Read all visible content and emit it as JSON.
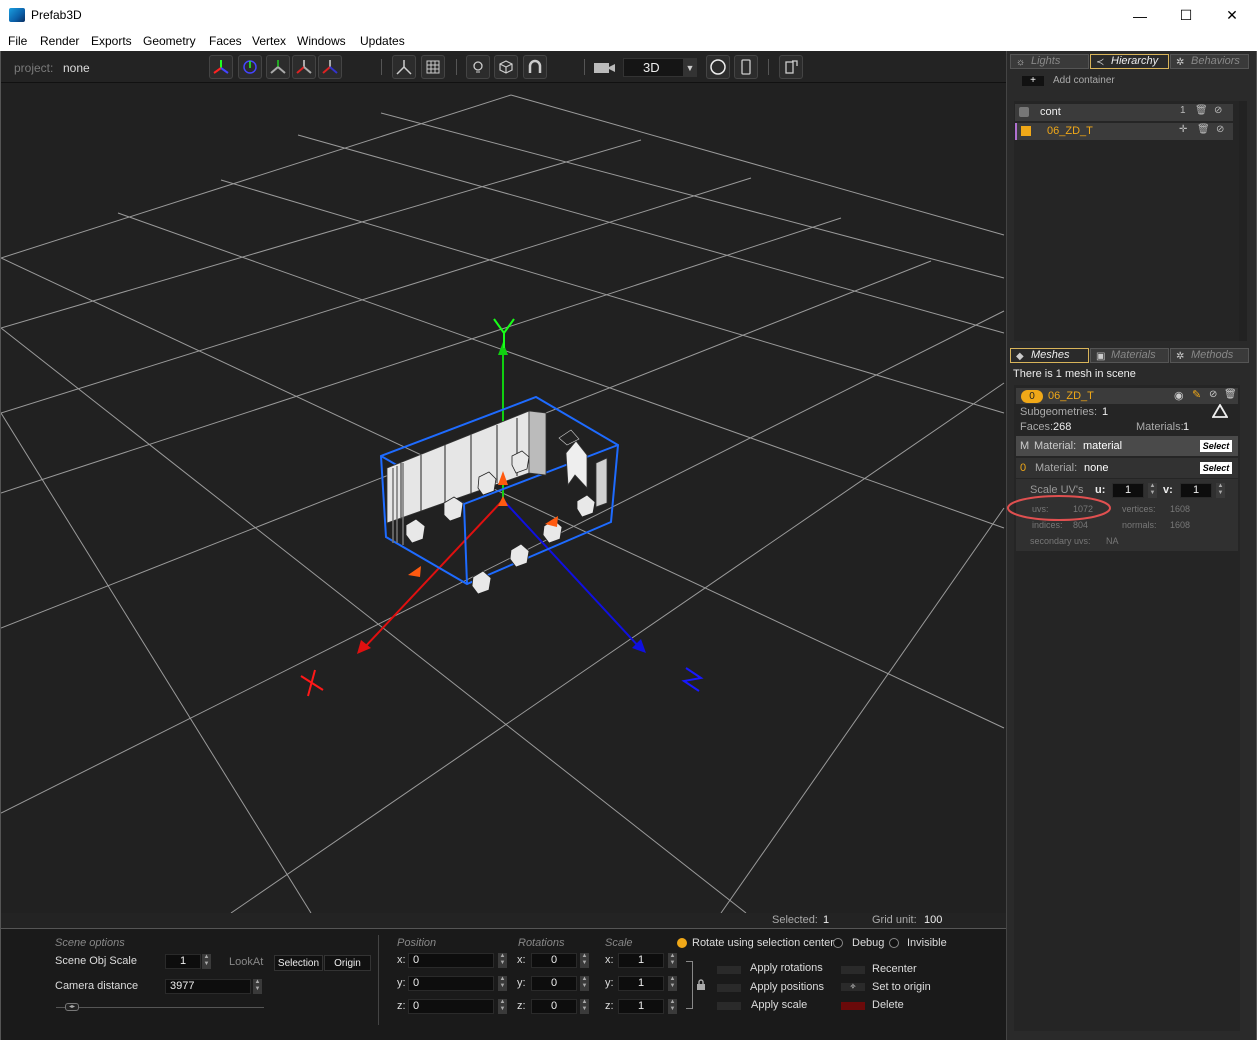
{
  "window": {
    "title": "Prefab3D",
    "minimize": "—",
    "maximize": "☐",
    "close": "✕"
  },
  "menu": [
    "File",
    "Render",
    "Exports",
    "Geometry",
    "Faces",
    "Vertex",
    "Windows",
    "Updates"
  ],
  "toolbar": {
    "project_label": "project:",
    "project_value": "none",
    "view_mode": "3D"
  },
  "viewport": {
    "axis_labels": {
      "x": "X",
      "y": "Y",
      "z": "Z"
    },
    "colors": {
      "x_axis": "#e01010",
      "y_axis": "#10d010",
      "z_axis": "#1010e0",
      "bbox": "#1e6bff",
      "grid": "#9a9a9a"
    }
  },
  "status": {
    "selected_label": "Selected:",
    "selected_value": "1",
    "grid_label": "Grid unit:",
    "grid_value": "100"
  },
  "scene_options": {
    "title": "Scene options",
    "obj_scale_label": "Scene Obj Scale",
    "obj_scale_value": "1",
    "lookat_label": "LookAt",
    "lookat_selection": "Selection",
    "lookat_origin": "Origin",
    "camera_distance_label": "Camera distance",
    "camera_distance_value": "3977"
  },
  "transform": {
    "position_title": "Position",
    "rotations_title": "Rotations",
    "scale_title": "Scale",
    "axes": [
      "x:",
      "y:",
      "z:"
    ],
    "position": [
      "0",
      "0",
      "0"
    ],
    "rotations": [
      "0",
      "0",
      "0"
    ],
    "scale": [
      "1",
      "1",
      "1"
    ]
  },
  "options": {
    "rotate_selection_center": "Rotate using selection center",
    "debug": "Debug",
    "invisible": "Invisible"
  },
  "actions": {
    "apply_rotations": "Apply rotations",
    "apply_positions": "Apply positions",
    "apply_scale": "Apply scale",
    "recenter": "Recenter",
    "set_to_origin": "Set to origin",
    "delete": "Delete"
  },
  "right_panel": {
    "top_tabs": [
      "Lights",
      "Hierarchy",
      "Behaviors"
    ],
    "add_container": "Add container",
    "hierarchy": [
      {
        "name": "cont",
        "count": "1"
      },
      {
        "name": "06_ZD_T"
      }
    ],
    "bottom_tabs": [
      "Meshes",
      "Materials",
      "Methods"
    ],
    "mesh_count_text": "There is 1 mesh in scene",
    "mesh": {
      "index": "0",
      "name": "06_ZD_T",
      "subgeometries_label": "Subgeometries:",
      "subgeometries_value": "1",
      "faces_label": "Faces:",
      "faces_value": "268",
      "materials_label": "Materials:",
      "materials_value": "1",
      "m_material_prefix": "M",
      "m_material_label": "Material:",
      "m_material_value": "material",
      "select_label": "Select",
      "sub_index": "0",
      "sub_material_label": "Material:",
      "sub_material_value": "none",
      "scale_uvs_label": "Scale UV's",
      "u_label": "u:",
      "u_value": "1",
      "v_label": "v:",
      "v_value": "1",
      "uvs_label": "uvs:",
      "uvs_value": "1072",
      "vertices_label": "vertices:",
      "vertices_value": "1608",
      "indices_label": "indices:",
      "indices_value": "804",
      "normals_label": "normals:",
      "normals_value": "1608",
      "secondary_uvs_label": "secondary uvs:",
      "secondary_uvs_value": "NA"
    }
  }
}
